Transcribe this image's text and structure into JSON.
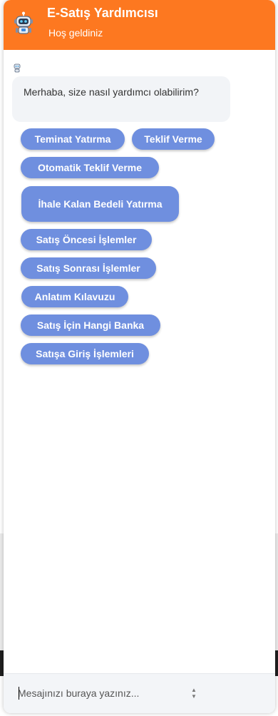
{
  "header": {
    "title": "E-Satış Yardımcısı",
    "subtitle": "Hoş geldiniz"
  },
  "chat": {
    "greeting": "Merhaba, size nasıl yardımcı olabilirim?",
    "quick_replies": [
      "Teminat Yatırma",
      "Teklif Verme",
      "Otomatik Teklif Verme",
      "İhale Kalan Bedeli Yatırma",
      "Satış Öncesi İşlemler",
      "Satış Sonrası İşlemler",
      "Anlatım Kılavuzu",
      "Satış İçin Hangi Banka",
      "Satışa Giriş İşlemleri"
    ]
  },
  "composer": {
    "placeholder": "Mesajınızı buraya yazınız..."
  },
  "colors": {
    "header_bg": "#fd7820",
    "quick_reply_bg": "#6f8fdf",
    "bubble_bg": "#f2f4f7"
  },
  "icons": {
    "avatar": "robot-icon",
    "spinner": "up-down-arrows-icon"
  }
}
